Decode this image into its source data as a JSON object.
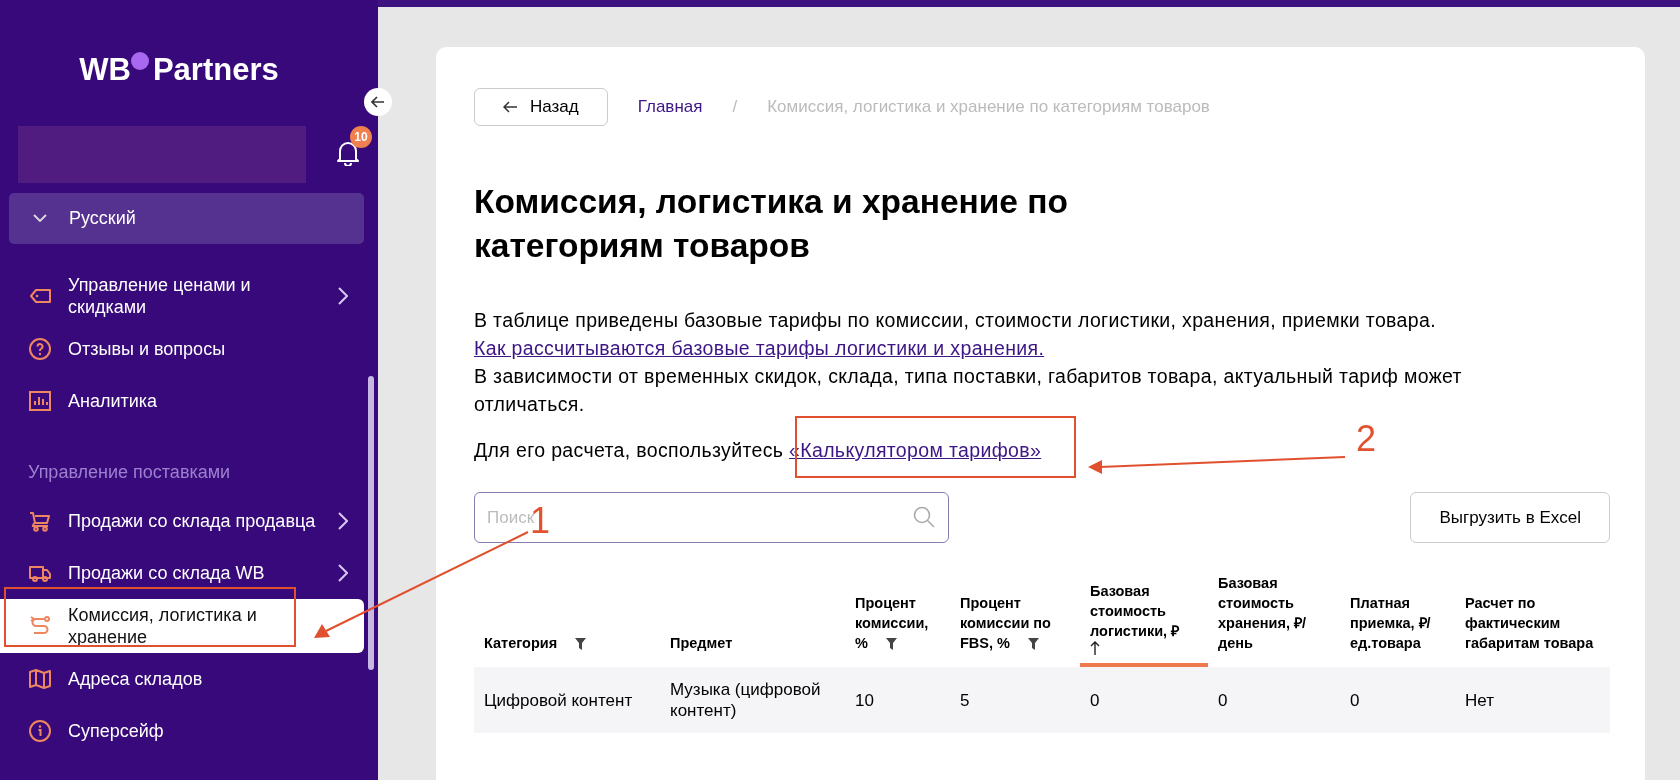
{
  "sidebar": {
    "logo_left": "WB",
    "logo_right": "Partners",
    "notification_count": "10",
    "language": "Русский",
    "items": [
      {
        "kind": "item",
        "label": "Управление ценами и скидками",
        "submenu": true,
        "selected": false
      },
      {
        "kind": "item",
        "label": "Отзывы и вопросы",
        "submenu": false,
        "selected": false
      },
      {
        "kind": "item",
        "label": "Аналитика",
        "submenu": false,
        "selected": false
      },
      {
        "kind": "section",
        "label": "Управление поставками"
      },
      {
        "kind": "item",
        "label": "Продажи со склада продавца",
        "submenu": true,
        "selected": false
      },
      {
        "kind": "item",
        "label": "Продажи со склада WB",
        "submenu": true,
        "selected": false
      },
      {
        "kind": "item",
        "label": "Комиссия, логистика и хранение",
        "submenu": false,
        "selected": true
      },
      {
        "kind": "item",
        "label": "Адреса складов",
        "submenu": false,
        "selected": false
      },
      {
        "kind": "item",
        "label": "Суперсейф",
        "submenu": false,
        "selected": false
      }
    ]
  },
  "breadcrumb": {
    "back": "Назад",
    "separator": "/",
    "items": [
      {
        "label": "Главная",
        "kind": "link"
      },
      {
        "label": "Комиссия, логистика и хранение по категориям товаров",
        "kind": "current"
      }
    ]
  },
  "title": "Комиссия, логистика и хранение по категориям товаров",
  "intro": {
    "text": "В таблице приведены базовые тарифы по комиссии, стоимости логистики, хранения, приемки товара.",
    "link": "Как рассчитываются базовые тарифы логистики и хранения."
  },
  "note": "В зависимости от временных скидок, склада, типа поставки, габаритов товара, актуальный тариф может отличаться.",
  "calculator": {
    "text": "Для его расчета, воспользуйтесь",
    "link": "«Калькулятором тарифов»"
  },
  "search": {
    "placeholder": "Поиск"
  },
  "export_button": "Выгрузить в Excel",
  "table": {
    "columns": [
      {
        "label": "Категория",
        "filter": true,
        "sorted": false
      },
      {
        "label": "Предмет",
        "filter": false,
        "sorted": false
      },
      {
        "label": "Процент комиссии, %",
        "filter": true,
        "sorted": false
      },
      {
        "label": "Процент комиссии по FBS, %",
        "filter": true,
        "sorted": false
      },
      {
        "label": "Базовая стоимость логистики, ₽",
        "filter": false,
        "sorted": true
      },
      {
        "label": "Базовая стоимость хранения, ₽/ день",
        "filter": false,
        "sorted": false
      },
      {
        "label": "Платная приемка, ₽/ ед.товара",
        "filter": false,
        "sorted": false
      },
      {
        "label": "Расчет по фактическим габаритам товара",
        "filter": false,
        "sorted": false
      }
    ],
    "rows": [
      [
        "Цифровой контент",
        "Музыка (цифровой контент)",
        "10",
        "5",
        "0",
        "0",
        "0",
        "Нет"
      ]
    ]
  },
  "annotations": [
    {
      "label": "1"
    },
    {
      "label": "2"
    }
  ]
}
